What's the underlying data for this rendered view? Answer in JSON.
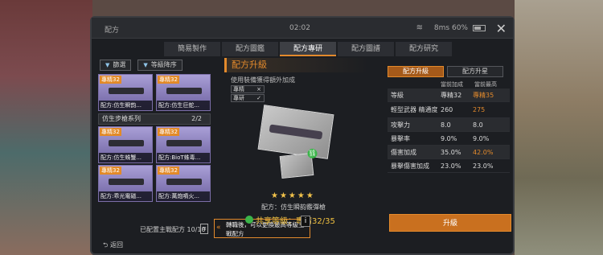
{
  "status_bar": {
    "title": "配方",
    "time": "02:02",
    "network": "8ms",
    "battery": "60%"
  },
  "tabs": [
    {
      "label": "簡易製作"
    },
    {
      "label": "配方圖鑑"
    },
    {
      "label": "配方專研"
    },
    {
      "label": "配方圖譜"
    },
    {
      "label": "配方研究"
    }
  ],
  "filters": {
    "filter": "篩選",
    "sort": "等級降序"
  },
  "list": {
    "top_cards": [
      {
        "badge": "專精32",
        "name": "配方:仿生瞬韵..."
      },
      {
        "badge": "專精32",
        "name": "配方:仿生巨蛇..."
      }
    ],
    "group": {
      "title": "仿生步槍系列",
      "count": "2/2"
    },
    "group_cards": [
      {
        "badge": "專精32",
        "name": "配方:仿生蛛蟹..."
      },
      {
        "badge": "專精32",
        "name": "配方:BioT蛛毒..."
      }
    ],
    "bottom_cards": [
      {
        "badge": "專精32",
        "name": "配方:乖光電磁..."
      },
      {
        "badge": "專精32",
        "name": "配方:萬炮噴火..."
      }
    ]
  },
  "assigned_text": "已配置主戰配方 10/10",
  "tip": "轉職後，可以更換最高等級主戰配方",
  "back_label": "返回",
  "center": {
    "header": "配方升級",
    "subtitle": "使用裝備獲得額外加成",
    "mini_rows": [
      {
        "label": "專精",
        "mark": "×"
      },
      {
        "label": "專研",
        "mark": "✓"
      }
    ],
    "stars": "★★★★★",
    "weapon_name": "配方：仿生瞬韵霰彈槍",
    "share": "共享等級：專精32/35"
  },
  "right": {
    "tabs": [
      {
        "label": "配方升級"
      },
      {
        "label": "配方升星"
      }
    ],
    "headers": {
      "current": "當前加成",
      "max": "當前最高"
    },
    "stats": [
      {
        "name": "等級",
        "current": "專精32",
        "max": "專精35",
        "highlight": true
      },
      {
        "name": "輕型武器 精通度",
        "current": "260",
        "max": "275",
        "highlight": true
      },
      {
        "name": "攻擊力",
        "current": "8.0",
        "max": "8.0",
        "highlight": false
      },
      {
        "name": "暴擊率",
        "current": "9.0%",
        "max": "9.0%",
        "highlight": false
      },
      {
        "name": "傷害加成",
        "current": "35.0%",
        "max": "42.0%",
        "highlight": true
      },
      {
        "name": "暴擊傷害加成",
        "current": "23.0%",
        "max": "23.0%",
        "highlight": false
      }
    ],
    "upgrade_label": "升級"
  }
}
